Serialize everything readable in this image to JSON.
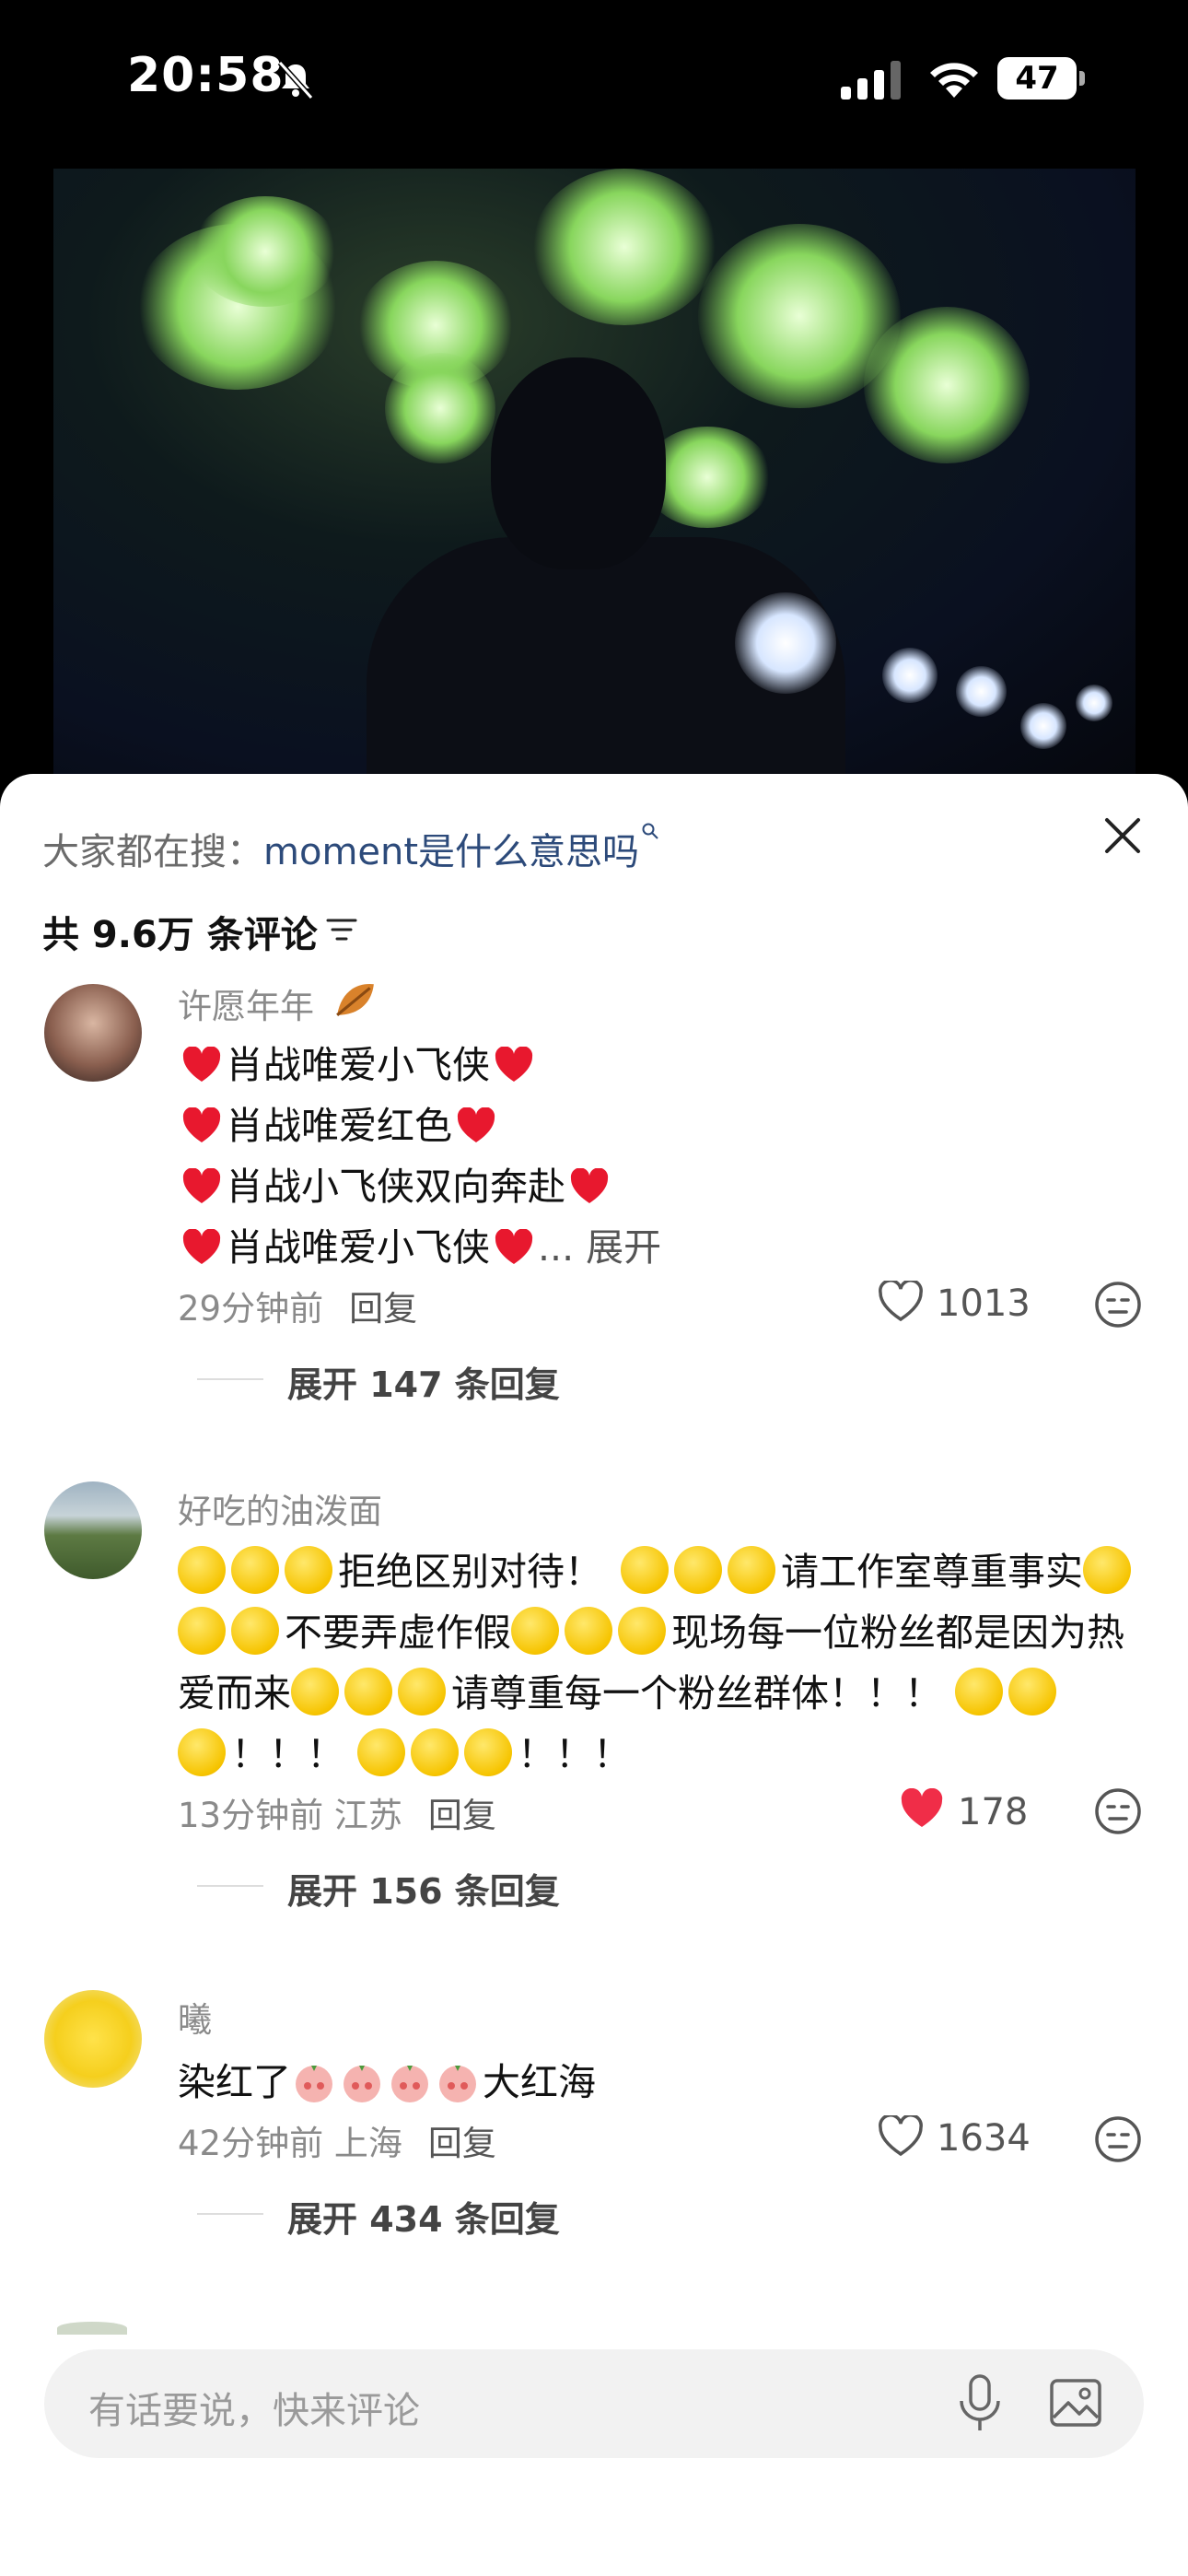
{
  "status_bar": {
    "time": "20:58",
    "battery": "47"
  },
  "search": {
    "prefix": "大家都在搜：",
    "keyword": "moment是什么意思吗"
  },
  "comments_header": {
    "count_text": "共 9.6万 条评论"
  },
  "comments": [
    {
      "username": "许愿年年",
      "lines": [
        "肖战唯爱小飞侠",
        "肖战唯爱红色",
        "肖战小飞侠双向奔赴",
        "肖战唯爱小飞侠"
      ],
      "expand_text": "... 展开",
      "time": "29分钟前",
      "location": "",
      "reply": "回复",
      "likes": "1013",
      "liked": false,
      "more_replies": "展开 147 条回复"
    },
    {
      "username": "好吃的油泼面",
      "line1": "拒绝区别对待！",
      "line1b": "请工作室尊重事实",
      "line2a": "不要弄虚作假",
      "line2b": "现场每一位粉丝都是因为热",
      "line3a": "爱而来",
      "line3b": "请尊重每一个粉丝群体！！！",
      "line4a": "！！！",
      "line4b": "！！！",
      "time": "13分钟前",
      "location": "江苏",
      "reply": "回复",
      "likes": "178",
      "liked": true,
      "more_replies": "展开 156 条回复"
    },
    {
      "username": "曦",
      "text_a": "染红了",
      "text_b": "大红海",
      "time": "42分钟前",
      "location": "上海",
      "reply": "回复",
      "likes": "1634",
      "liked": false,
      "more_replies": "展开 434 条回复"
    }
  ],
  "input": {
    "placeholder": "有话要说，快来评论"
  },
  "colors": {
    "like_red": "#f02d48",
    "keyword_blue": "#2c4a7a",
    "heart_emoji": "#e8182e",
    "emoji_yellow": "#f6c400"
  }
}
